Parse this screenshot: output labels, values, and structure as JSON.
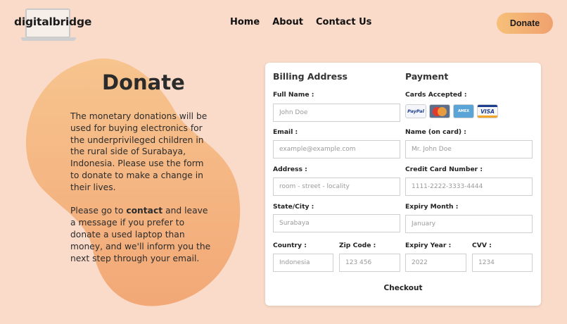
{
  "brand": {
    "name": "digitalbridge"
  },
  "nav": {
    "items": [
      "Home",
      "About",
      "Contact Us"
    ]
  },
  "header": {
    "donate_label": "Donate"
  },
  "hero": {
    "title": "Donate",
    "paragraph1": "The monetary donations will be used for buying electronics for the underprivileged children in the rural side of Surabaya, Indonesia. Please use the form to donate to make a change in their lives.",
    "paragraph2_prefix": "Please go to ",
    "paragraph2_link": "contact",
    "paragraph2_suffix": " and leave a message if you prefer to donate a used laptop than money, and we'll inform you the next step through your email."
  },
  "billing": {
    "title": "Billing Address",
    "full_name": {
      "label": "Full Name :",
      "placeholder": "John Doe"
    },
    "email": {
      "label": "Email :",
      "placeholder": "example@example.com"
    },
    "address": {
      "label": "Address :",
      "placeholder": "room - street - locality"
    },
    "state_city": {
      "label": "State/City :",
      "placeholder": "Surabaya"
    },
    "country": {
      "label": "Country :",
      "placeholder": "Indonesia"
    },
    "zip": {
      "label": "Zip Code :",
      "placeholder": "123 456"
    }
  },
  "payment": {
    "title": "Payment",
    "cards_label": "Cards Accepted :",
    "cards": [
      {
        "name": "PayPal",
        "icon": "paypal-icon"
      },
      {
        "name": "MasterCard",
        "icon": "mastercard-icon"
      },
      {
        "name": "AMERICAN EXPRESS",
        "icon": "amex-icon"
      },
      {
        "name": "VISA",
        "icon": "visa-icon"
      }
    ],
    "name_on_card": {
      "label": "Name (on card) :",
      "placeholder": "Mr. John Doe"
    },
    "card_number": {
      "label": "Credit Card Number :",
      "placeholder": "1111-2222-3333-4444"
    },
    "expiry_month": {
      "label": "Expiry Month :",
      "placeholder": "January"
    },
    "expiry_year": {
      "label": "Expiry Year :",
      "placeholder": "2022"
    },
    "cvv": {
      "label": "CVV :",
      "placeholder": "1234"
    }
  },
  "form": {
    "checkout_label": "Checkout"
  },
  "colors": {
    "page_bg": "#fadbca",
    "blob_top": "#f7c48e",
    "blob_bottom": "#f2a877",
    "button_gradient_start": "#f6c079",
    "button_gradient_end": "#f0a16e"
  }
}
